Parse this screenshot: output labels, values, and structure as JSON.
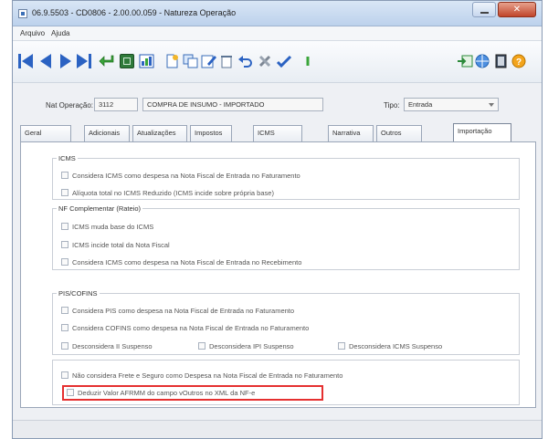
{
  "window": {
    "title": "06.9.5503 - CD0806 - 2.00.00.059 - Natureza Operação"
  },
  "menu": [
    "Arquivo",
    "Ajuda"
  ],
  "toolbar": {
    "icons": [
      "first-record-icon",
      "previous-record-icon",
      "next-record-icon",
      "last-record-icon",
      "return-icon",
      "grid-view-icon",
      "chart-icon",
      "new-document-icon",
      "copy-icon",
      "edit-icon",
      "delete-icon",
      "undo-icon",
      "tools-icon",
      "save-check-icon",
      "refresh-icon",
      "export-icon",
      "web-icon",
      "notebook-icon",
      "help-icon"
    ]
  },
  "header": {
    "nat_label": "Nat Operação:",
    "nat_code": "3112",
    "nat_desc": "COMPRA DE INSUMO - IMPORTADO",
    "tipo_label": "Tipo:",
    "tipo_value": "Entrada"
  },
  "tabs": [
    "Geral",
    "Adicionais",
    "Atualizações",
    "Impostos",
    "ICMS",
    "Narrativa",
    "Outros",
    "Importação"
  ],
  "active_tab": "Importação",
  "icms": {
    "title": "ICMS",
    "opt1": "Considera ICMS como despesa na Nota Fiscal de Entrada no Faturamento",
    "opt2": "Alíquota total no ICMS Reduzido (ICMS incide sobre própria base)"
  },
  "nf": {
    "title": "NF Complementar (Rateio)",
    "opt1": "ICMS muda base do ICMS",
    "opt2": "ICMS incide total da Nota Fiscal",
    "opt3": "Considera ICMS como despesa na Nota Fiscal de Entrada no Recebimento"
  },
  "pis": {
    "title": "PIS/COFINS",
    "opt1": "Considera PIS como despesa na Nota Fiscal de Entrada no Faturamento",
    "opt2": "Considera COFINS como despesa na Nota Fiscal de Entrada no Faturamento",
    "opt3": "Desconsidera II Suspenso",
    "opt4": "Desconsidera IPI Suspenso",
    "opt5": "Desconsidera ICMS Suspenso"
  },
  "other": {
    "opt1": "Não considera Frete e Seguro como Despesa na Nota Fiscal de Entrada no Faturamento",
    "opt2": "Deduzir Valor AFRMM do campo vOutros no XML da NF-e"
  },
  "colors": {
    "highlight": "#e53030",
    "nav_blue": "#2b62c2"
  }
}
